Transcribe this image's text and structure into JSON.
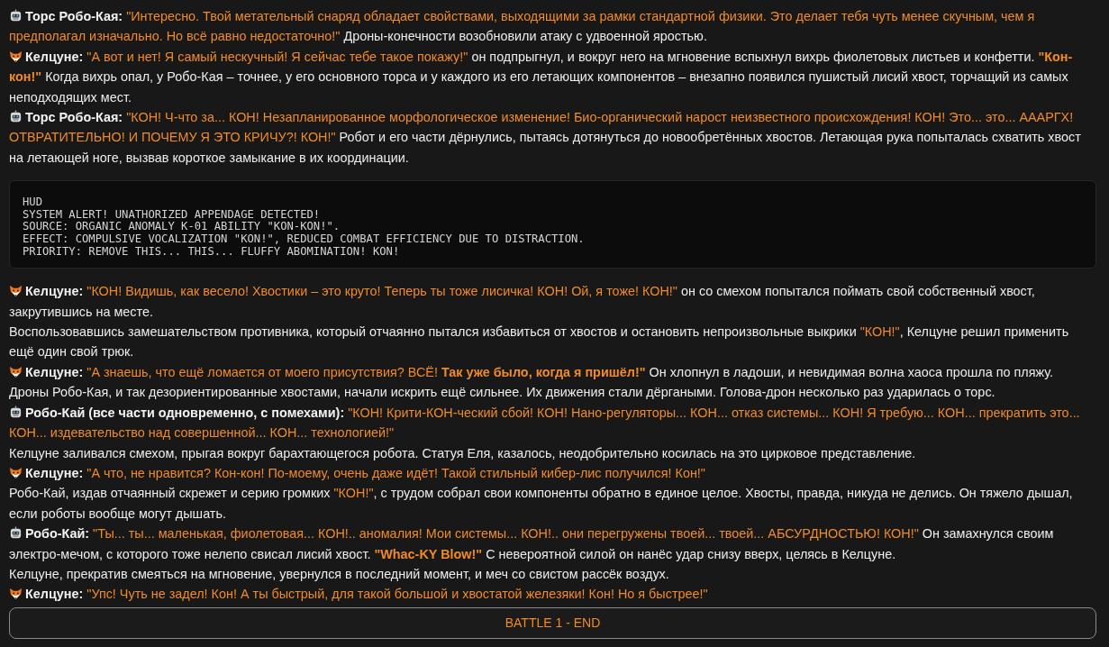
{
  "story_before": [
    {
      "kind": "robot_speech",
      "segments": [
        {
          "kind": "speaker",
          "text": "Торс Робо-Кая:"
        },
        {
          "kind": "quote",
          "text": "\"Интересно. Твой метательный снаряд обладает свойствами, выходящими за рамки стандартной физики. Это делает тебя чуть менее скучным, чем я предполагал изначально. Но всё равно недостаточно!\""
        },
        {
          "kind": "narration",
          "text": "Дроны-конечности возобновили атаку с удвоенной яростью."
        }
      ]
    },
    {
      "kind": "fox_speech",
      "segments": [
        {
          "kind": "speaker",
          "text": "Келцуне:"
        },
        {
          "kind": "quote",
          "text": "\"А вот и нет! Я самый нескучный! Я сейчас тебе такое покажу!\""
        },
        {
          "kind": "narration",
          "text": "он подпрыгнул, и вокруг него на мгновение вспыхнул вихрь фиолетовых листьев и конфетти."
        },
        {
          "kind": "shout",
          "text": "\"Кон-кон!\""
        },
        {
          "kind": "narration",
          "text": "Когда вихрь опал, у Робо-Кая – точнее, у его основного торса и у каждого из его летающих компонентов – внезапно появился пушистый лисий хвост, торчащий из самых неподходящих мест."
        }
      ]
    },
    {
      "kind": "robot_speech",
      "segments": [
        {
          "kind": "speaker",
          "text": "Торс Робо-Кая:"
        },
        {
          "kind": "quote",
          "text": "\"КОН! Ч-что за... КОН! Незапланированное морфологическое изменение! Био-органический нарост неизвестного происхождения! КОН! Это... это... АААРГХ! ОТВРАТИТЕЛЬНО! И ПОЧЕМУ Я ЭТО КРИЧУ?! КОН!\""
        },
        {
          "kind": "narration",
          "text": "Робот и его части дёрнулись, пытаясь дотянуться до новообретённых хвостов. Летающая рука попыталась схватить хвост на летающей ноге, вызвав короткое замыкание в их координации."
        }
      ]
    }
  ],
  "hud": {
    "lines": [
      "HUD",
      "SYSTEM ALERT! UNATHORIZED APPENDAGE DETECTED!",
      "SOURCE: ORGANIC ANOMALY K-01 ABILITY \"KON-KON!\".",
      "EFFECT: COMPULSIVE VOCALIZATION \"KON!\", REDUCED COMBAT EFFICIENCY DUE TO DISTRACTION.",
      "PRIORITY: REMOVE THIS... THIS... FLUFFY ABOMINATION! KON!"
    ]
  },
  "story_after": [
    {
      "kind": "fox_speech",
      "segments": [
        {
          "kind": "speaker",
          "text": "Келцуне:"
        },
        {
          "kind": "quote",
          "text": "\"КОН! Видишь, как весело! Хвостики – это круто! Теперь ты тоже лисичка! КОН! Ой, я тоже! КОН!\""
        },
        {
          "kind": "narration",
          "text": "он со смехом попытался поймать свой собственный хвост, закрутившись на месте."
        }
      ]
    },
    {
      "kind": "narration",
      "segments": [
        {
          "kind": "narration",
          "text": "Воспользовавшись замешательством противника, который отчаянно пытался избавиться от хвостов и остановить непроизвольные выкрики"
        },
        {
          "kind": "quote",
          "text": "\"КОН!\""
        },
        {
          "kind": "narration",
          "text": ", Келцуне решил применить ещё один свой трюк."
        }
      ]
    },
    {
      "kind": "fox_speech",
      "segments": [
        {
          "kind": "speaker",
          "text": "Келцуне:"
        },
        {
          "kind": "quote",
          "text": "\"А знаешь, что ещё ломается от моего присутствия? ВСЁ!"
        },
        {
          "kind": "shout",
          "text": "Так уже было, когда я пришёл!\""
        },
        {
          "kind": "narration",
          "text": "Он хлопнул в ладоши, и невидимая волна хаоса прошла по пляжу."
        }
      ]
    },
    {
      "kind": "narration",
      "segments": [
        {
          "kind": "narration",
          "text": "Дроны Робо-Кая, и так дезориентированные хвостами, начали искрить ещё сильнее. Их движения стали дёргаными. Голова-дрон несколько раз ударилась о торс."
        }
      ]
    },
    {
      "kind": "robot_speech",
      "segments": [
        {
          "kind": "speaker",
          "text": "Робо-Кай (все части одновременно, с помехами):"
        },
        {
          "kind": "quote",
          "text": "\"КОН! Крити-КОН-ческий сбой! КОН! Нано-регуляторы... КОН... отказ системы... КОН! Я требую... КОН... прекратить это... КОН... издевательство над совершенной... КОН... технологией!\""
        }
      ]
    },
    {
      "kind": "narration",
      "segments": [
        {
          "kind": "narration",
          "text": "Келцуне заливался смехом, прыгая вокруг барахтающегося робота. Статуя Еля, казалось, неодобрительно косилась на это цирковое представление."
        }
      ]
    },
    {
      "kind": "fox_speech",
      "segments": [
        {
          "kind": "speaker",
          "text": "Келцуне:"
        },
        {
          "kind": "quote",
          "text": "\"А что, не нравится? Кон-кон! По-моему, очень даже идёт! Такой стильный кибер-лис получился! Кон!\""
        }
      ]
    },
    {
      "kind": "narration",
      "segments": [
        {
          "kind": "narration",
          "text": "Робо-Кай, издав отчаянный скрежет и серию громких"
        },
        {
          "kind": "quote",
          "text": "\"КОН!\""
        },
        {
          "kind": "narration",
          "text": ", с трудом собрал свои компоненты обратно в единое целое. Хвосты, правда, никуда не делись. Он тяжело дышал, если роботы вообще могут дышать."
        }
      ]
    },
    {
      "kind": "robot_speech",
      "segments": [
        {
          "kind": "speaker",
          "text": "Робо-Кай:"
        },
        {
          "kind": "quote",
          "text": "\"Ты... ты... маленькая, фиолетовая... КОН!.. аномалия! Мои системы... КОН!.. они перегружены твоей... твоей... АБСУРДНОСТЬЮ! КОН!\""
        },
        {
          "kind": "narration",
          "text": "Он замахнулся своим электро-мечом, с которого тоже нелепо свисал лисий хвост."
        },
        {
          "kind": "shout",
          "text": "\"Whac-KY Blow!\""
        },
        {
          "kind": "narration",
          "text": "С невероятной силой он нанёс удар снизу вверх, целясь в Келцуне."
        }
      ]
    },
    {
      "kind": "narration",
      "segments": [
        {
          "kind": "narration",
          "text": "Келцуне, прекратив смеяться на мгновение, увернулся в последний момент, и меч со свистом рассёк воздух."
        }
      ]
    },
    {
      "kind": "fox_speech",
      "segments": [
        {
          "kind": "speaker",
          "text": "Келцуне:"
        },
        {
          "kind": "quote",
          "text": "\"Упс! Чуть не задел! Кон! А ты быстрый, для такой большой и хвостатой железяки! Кон! Но я быстрее!\""
        }
      ]
    }
  ],
  "end_button": {
    "label": "BATTLE 1 - END"
  }
}
